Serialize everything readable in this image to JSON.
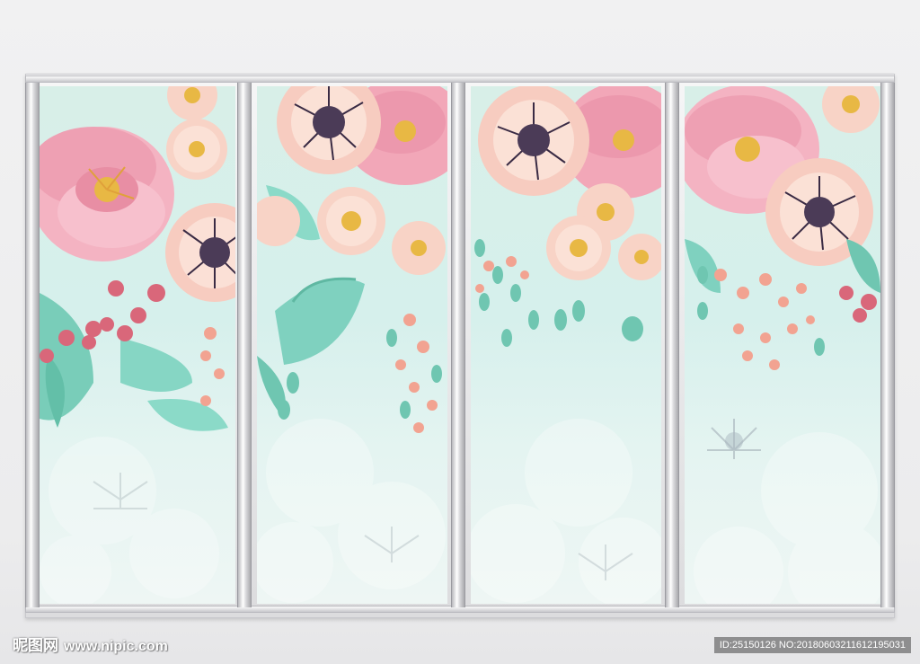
{
  "watermark": {
    "logo": "昵图网",
    "site": "www.nipic.com",
    "id_text": "ID:25150126 NO:20180603211612195031"
  },
  "colors": {
    "pink_flower": "#f2a7b8",
    "peach_flower": "#f8d3c6",
    "leaf": "#7fd1bf",
    "berry": "#d9677a",
    "center_dark": "#4b3b57",
    "pollen": "#e8b844",
    "frame": "#e9e9eb"
  },
  "panels": [
    "panel-1",
    "panel-2",
    "panel-3",
    "panel-4"
  ]
}
